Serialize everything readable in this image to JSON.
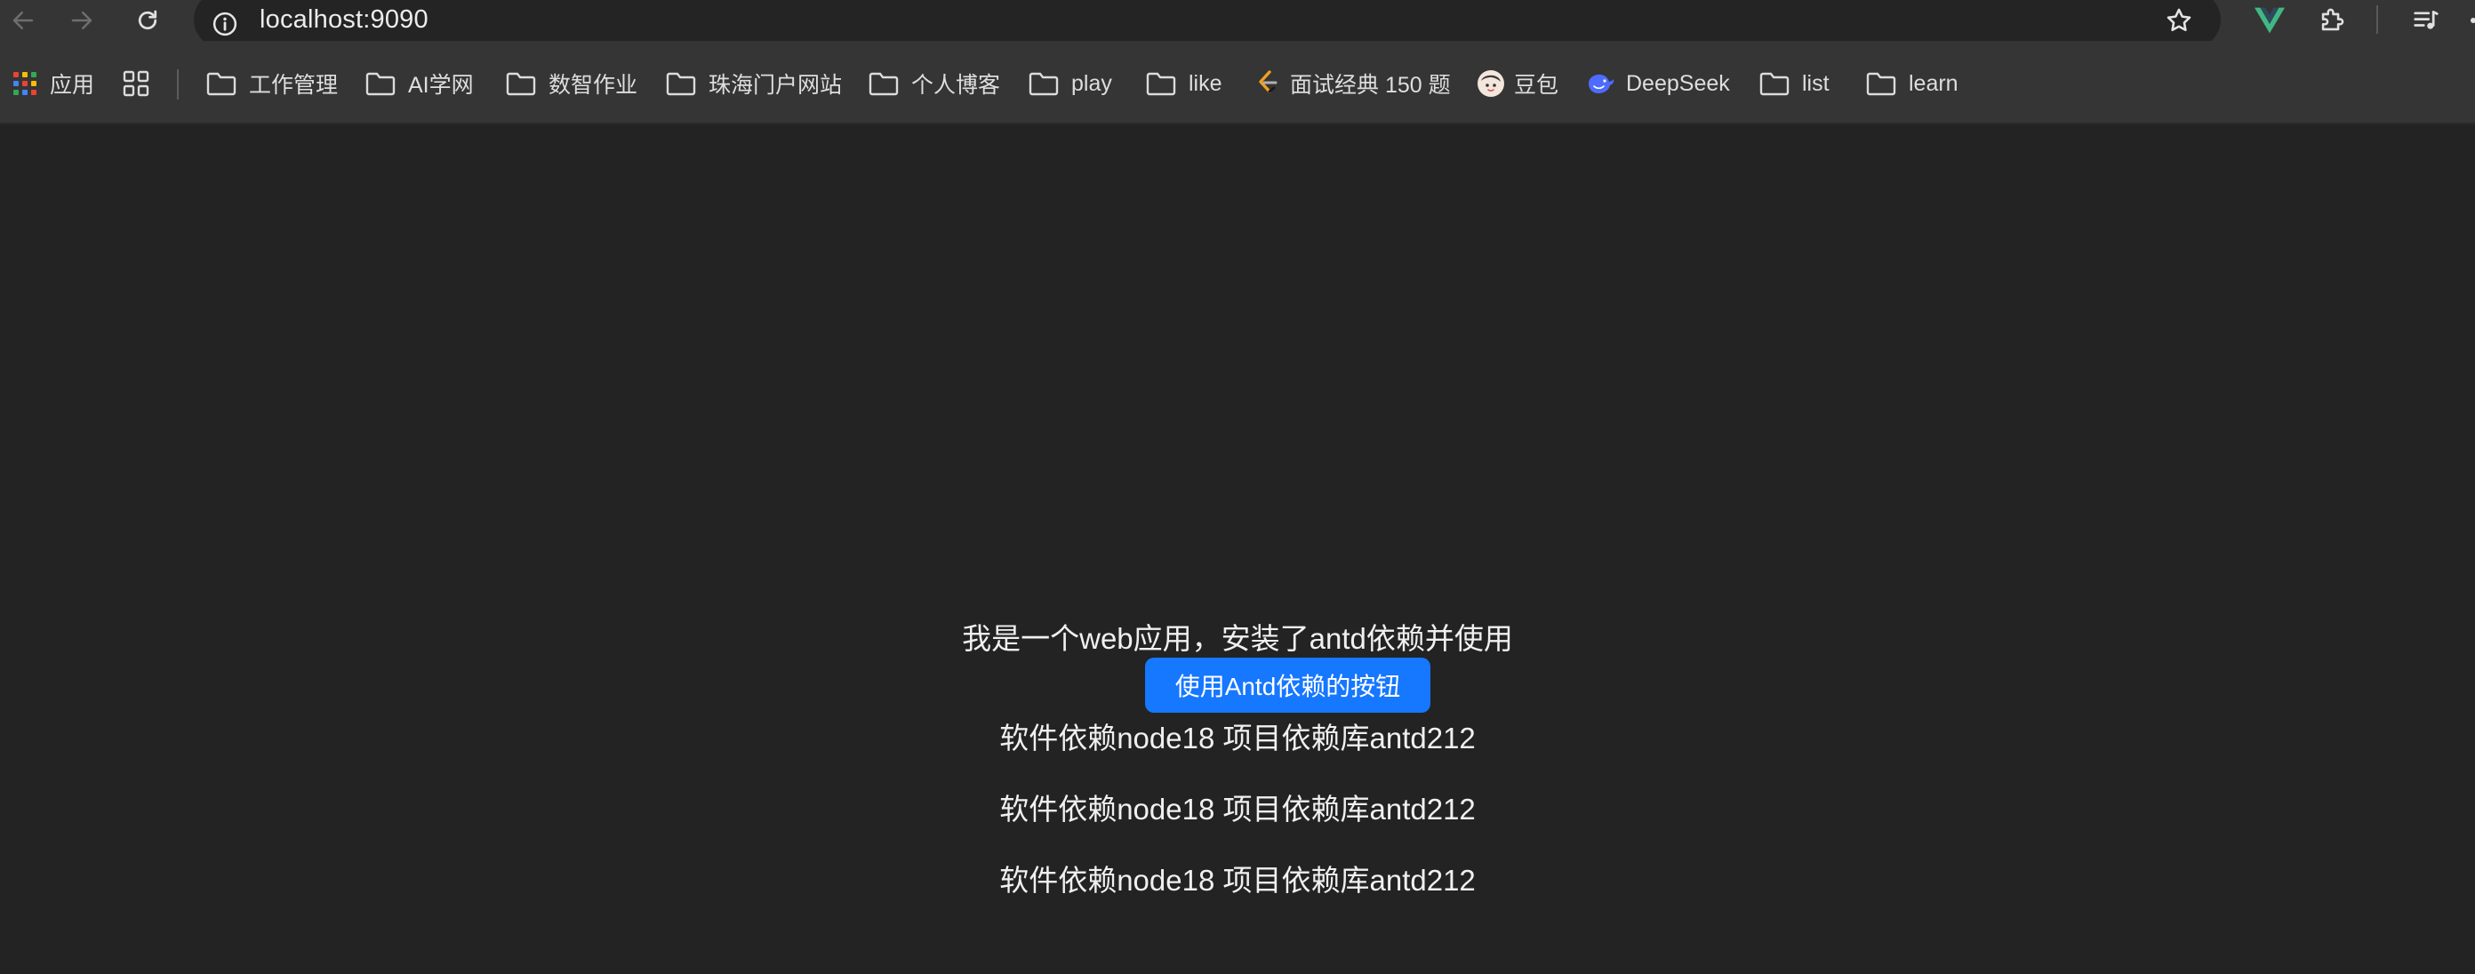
{
  "browser": {
    "url": "localhost:9090"
  },
  "bookmarks": [
    {
      "label": "应用",
      "icon": "apps-grid-icon"
    },
    {
      "label": "",
      "icon": "tab-groups-icon"
    },
    {
      "label": "工作管理",
      "icon": "folder-icon"
    },
    {
      "label": "AI学网",
      "icon": "folder-icon"
    },
    {
      "label": "数智作业",
      "icon": "folder-icon"
    },
    {
      "label": "珠海门户网站",
      "icon": "folder-icon"
    },
    {
      "label": "个人博客",
      "icon": "folder-icon"
    },
    {
      "label": "play",
      "icon": "folder-icon"
    },
    {
      "label": "like",
      "icon": "folder-icon"
    },
    {
      "label": "面试经典 150 题",
      "icon": "leetcode-icon"
    },
    {
      "label": "豆包",
      "icon": "doubao-icon"
    },
    {
      "label": "DeepSeek",
      "icon": "deepseek-icon"
    },
    {
      "label": "list",
      "icon": "folder-icon"
    },
    {
      "label": "learn",
      "icon": "folder-icon"
    }
  ],
  "page": {
    "intro": "我是一个web应用，安装了antd依赖并使用",
    "button_label": "使用Antd依赖的按钮",
    "dependency_lines": [
      "软件依赖node18 项目依赖库antd212",
      "软件依赖node18 项目依赖库antd212",
      "软件依赖node18 项目依赖库antd212"
    ]
  },
  "colors": {
    "primary_button": "#1677ff",
    "background": "#232323",
    "chrome": "#353535"
  }
}
